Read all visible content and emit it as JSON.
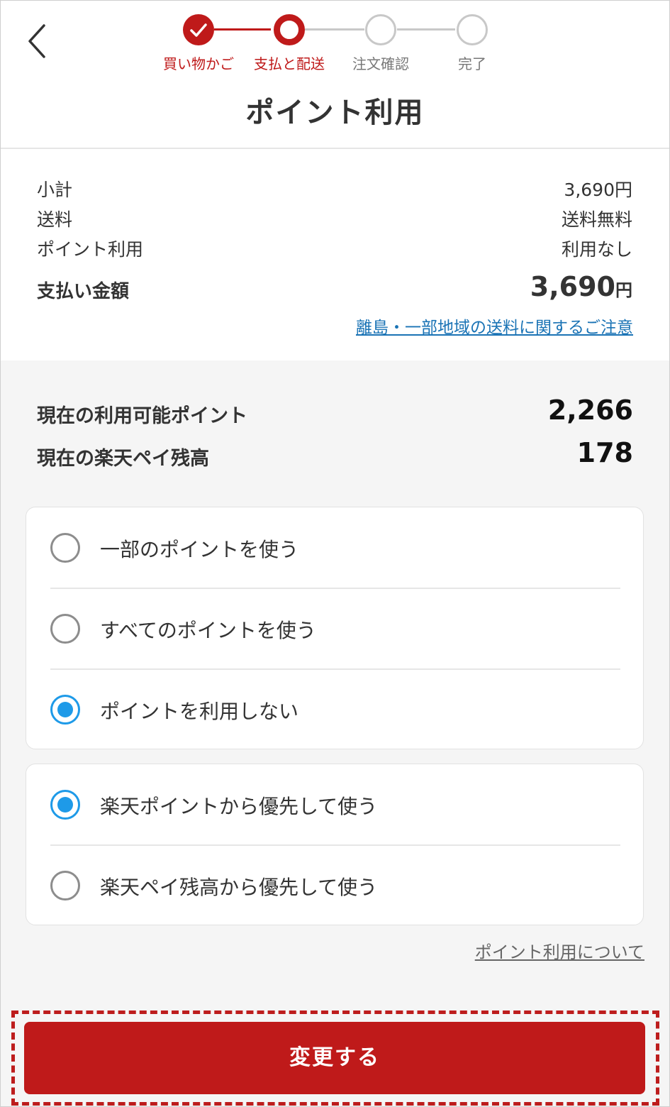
{
  "stepper": {
    "steps": [
      {
        "label": "買い物かご",
        "state": "done"
      },
      {
        "label": "支払と配送",
        "state": "current"
      },
      {
        "label": "注文確認",
        "state": "todo"
      },
      {
        "label": "完了",
        "state": "todo"
      }
    ]
  },
  "header": {
    "title": "ポイント利用",
    "back_icon": "chevron-left-icon"
  },
  "summary": {
    "subtotal_label": "小計",
    "subtotal_value": "3,690円",
    "shipping_label": "送料",
    "shipping_value": "送料無料",
    "points_label": "ポイント利用",
    "points_value": "利用なし",
    "total_label": "支払い金額",
    "total_value": "3,690",
    "total_unit": "円",
    "notice_link": "離島・一部地域の送料に関するご注意"
  },
  "points": {
    "available_label": "現在の利用可能ポイント",
    "available_value": "2,266",
    "balance_label": "現在の楽天ペイ残高",
    "balance_value": "178"
  },
  "usage_options": [
    {
      "label": "一部のポイントを使う",
      "selected": false
    },
    {
      "label": "すべてのポイントを使う",
      "selected": false
    },
    {
      "label": "ポイントを利用しない",
      "selected": true
    }
  ],
  "priority_options": [
    {
      "label": "楽天ポイントから優先して使う",
      "selected": true
    },
    {
      "label": "楽天ペイ残高から優先して使う",
      "selected": false
    }
  ],
  "about_link": "ポイント利用について",
  "submit_label": "変更する",
  "colors": {
    "brand": "#bf1a1a",
    "radio_on": "#1e9ae8",
    "link": "#1a73b5"
  }
}
